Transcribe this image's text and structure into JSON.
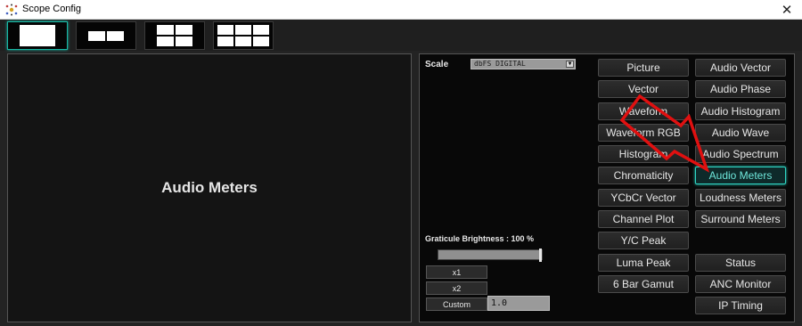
{
  "window": {
    "title": "Scope Config",
    "close_glyph": "✕",
    "icon": "app-logo-icon"
  },
  "layouts": [
    {
      "name": "layout-single",
      "cols": 1,
      "rows": 1,
      "active": true
    },
    {
      "name": "layout-two",
      "cols": 2,
      "rows": 1,
      "active": false
    },
    {
      "name": "layout-four",
      "cols": 2,
      "rows": 2,
      "active": false
    },
    {
      "name": "layout-six",
      "cols": 3,
      "rows": 2,
      "active": false
    }
  ],
  "preview": {
    "label": "Audio Meters"
  },
  "panel": {
    "scale_label": "Scale",
    "scale_value": "dbFS DIGITAL",
    "brightness_label": "Graticule Brightness : 100 %",
    "brightness_value": 1.0,
    "x1_label": "x1",
    "x2_label": "x2",
    "custom_label": "Custom",
    "custom_value": "1.0"
  },
  "scopes_left": [
    "Picture",
    "Vector",
    "Waveform",
    "Waveform RGB",
    "Histogram",
    "Chromaticity",
    "YCbCr Vector",
    "Channel Plot",
    "Y/C Peak",
    "Luma Peak",
    "6 Bar Gamut"
  ],
  "scopes_right": [
    "Audio Vector",
    "Audio Phase",
    "Audio Histogram",
    "Audio Wave",
    "Audio Spectrum",
    "Audio Meters",
    "Loudness Meters",
    "Surround Meters",
    "",
    "Status",
    "ANC Monitor",
    "IP Timing"
  ],
  "selected_scope": "Audio Meters",
  "colors": {
    "accent": "#2fd6c4",
    "annotation": "#e01010"
  }
}
